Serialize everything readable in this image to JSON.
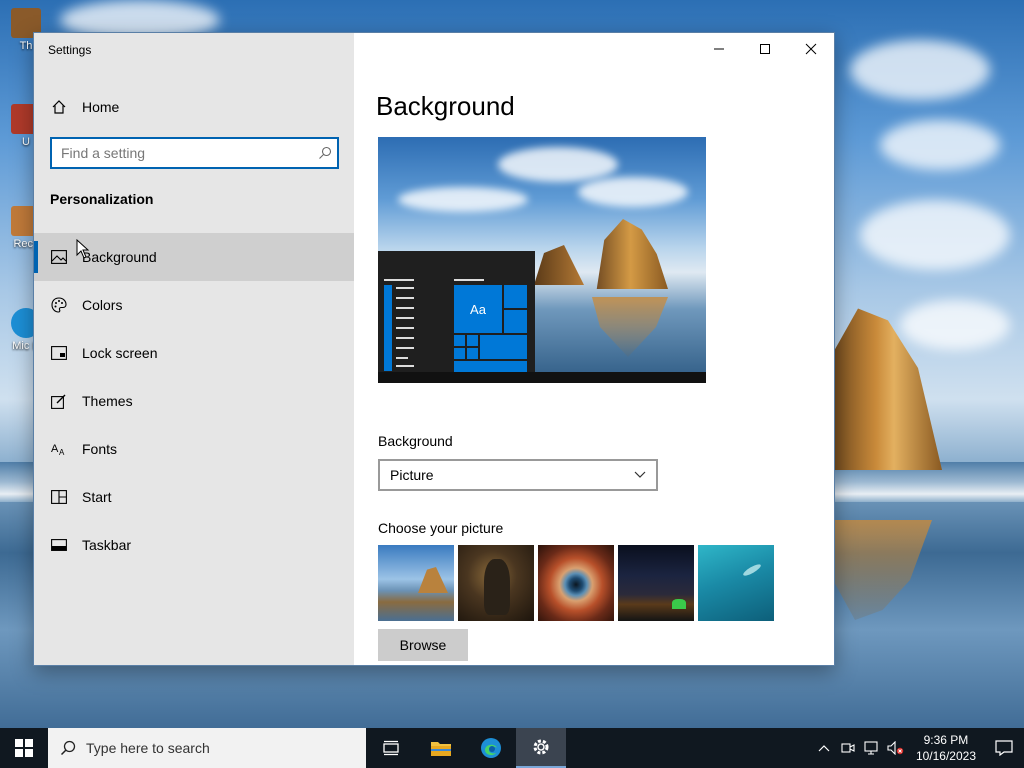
{
  "desktop": {
    "icons": [
      {
        "label": "Th"
      },
      {
        "label": "U"
      },
      {
        "label": "Recy"
      },
      {
        "label": "Mic E"
      }
    ]
  },
  "window": {
    "title": "Settings",
    "controls": {
      "minimize": "minimize-icon",
      "maximize": "maximize-icon",
      "close": "close-icon"
    }
  },
  "sidebar": {
    "home_label": "Home",
    "search_placeholder": "Find a setting",
    "section_title": "Personalization",
    "items": [
      {
        "label": "Background",
        "icon": "picture-icon",
        "selected": true
      },
      {
        "label": "Colors",
        "icon": "palette-icon"
      },
      {
        "label": "Lock screen",
        "icon": "lock-screen-icon"
      },
      {
        "label": "Themes",
        "icon": "themes-icon"
      },
      {
        "label": "Fonts",
        "icon": "fonts-icon"
      },
      {
        "label": "Start",
        "icon": "start-icon"
      },
      {
        "label": "Taskbar",
        "icon": "taskbar-icon"
      }
    ]
  },
  "main": {
    "title": "Background",
    "preview_tile_text": "Aa",
    "background_label": "Background",
    "background_value": "Picture",
    "choose_label": "Choose your picture",
    "browse_label": "Browse"
  },
  "taskbar": {
    "search_text": "Type here to search",
    "time": "9:36 PM",
    "date": "10/16/2023"
  },
  "colors": {
    "accent": "#0063b1",
    "sidebar_bg": "#e6e6e6",
    "selected_bg": "#cfcfcf",
    "taskbar_bg": "#101820"
  }
}
